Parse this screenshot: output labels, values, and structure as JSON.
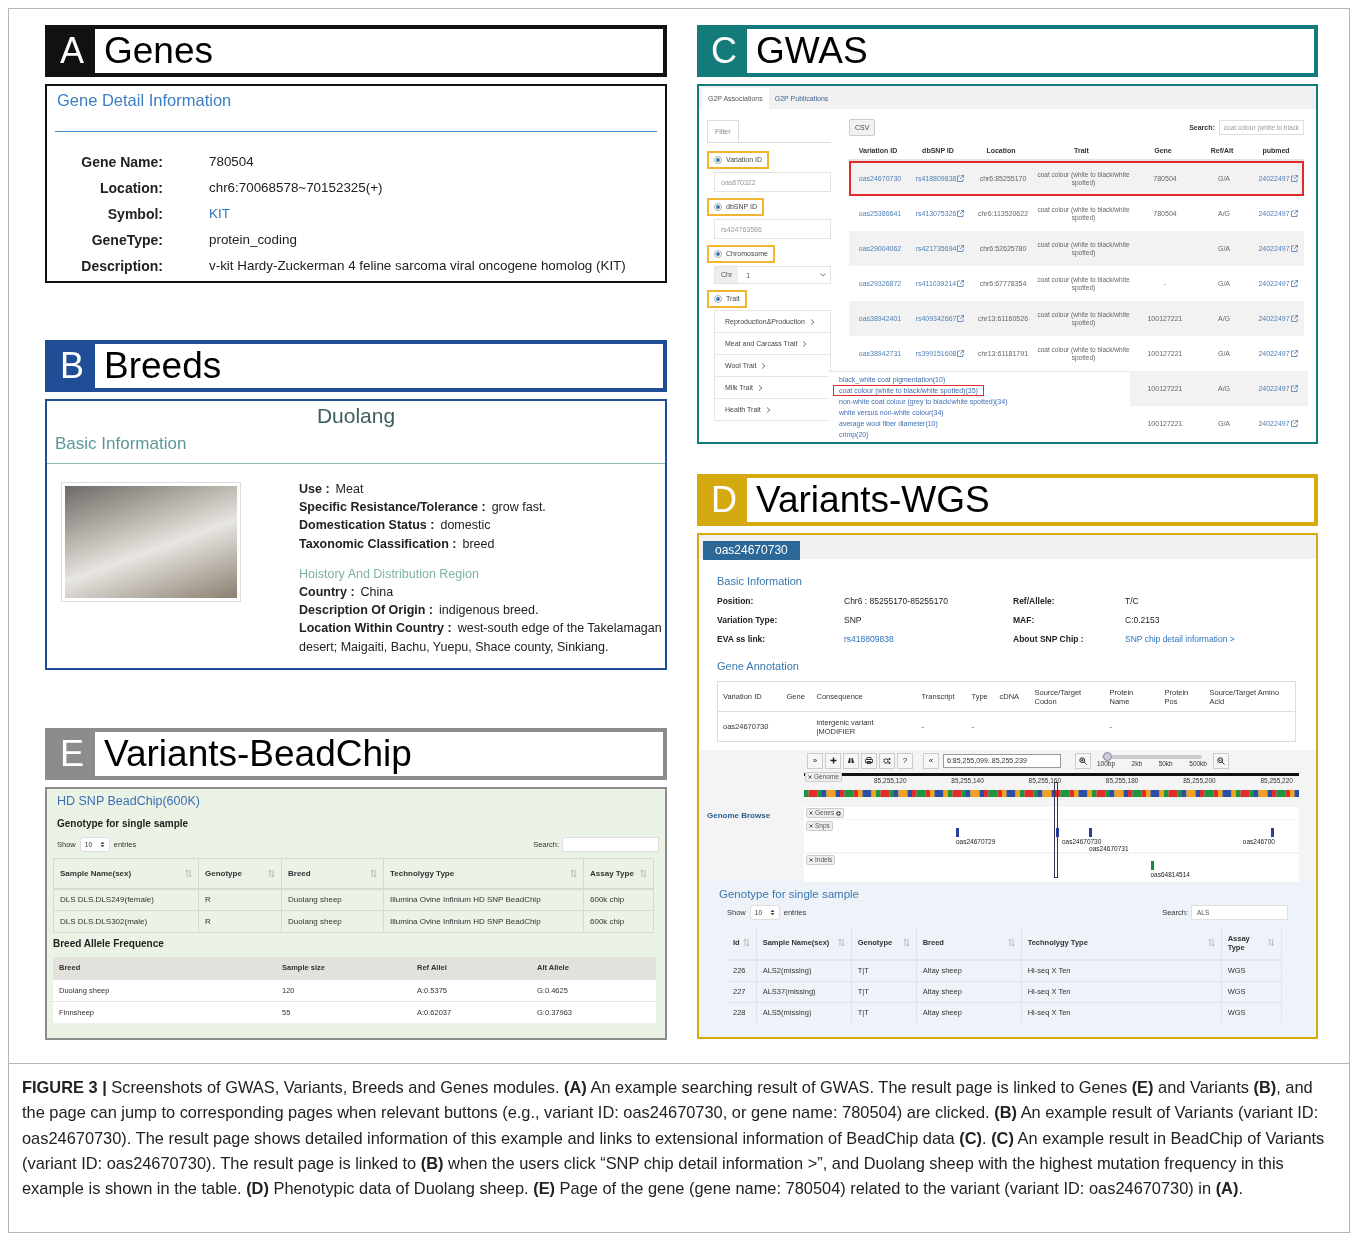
{
  "panel_a": {
    "letter": "A",
    "title": "Genes",
    "section_title": "Gene Detail Information",
    "fields": [
      {
        "label": "Gene Name:",
        "value": "780504",
        "kind": "text"
      },
      {
        "label": "Location:",
        "value": "chr6:70068578~70152325(+)",
        "kind": "text"
      },
      {
        "label": "Symbol:",
        "value": "KIT",
        "kind": "link"
      },
      {
        "label": "GeneType:",
        "value": "protein_coding",
        "kind": "text"
      },
      {
        "label": "Description:",
        "value": "v-kit Hardy-Zuckerman 4 feline sarcoma viral oncogene homolog (KIT)",
        "kind": "text"
      }
    ]
  },
  "panel_b": {
    "letter": "B",
    "title": "Breeds",
    "breed_name": "Duolang",
    "section_title": "Basic Information",
    "traits": [
      {
        "label": "Use :",
        "value": "Meat"
      },
      {
        "label": "Specific Resistance/Tolerance :",
        "value": "grow fast."
      },
      {
        "label": "Domestication Status :",
        "value": "domestic"
      },
      {
        "label": "Taxonomic Classification :",
        "value": "breed"
      }
    ],
    "history_title": "Hoistory And Distribution Region",
    "history": [
      {
        "label": "Country :",
        "value": "China"
      },
      {
        "label": "Description Of Origin :",
        "value": "indigenous breed."
      },
      {
        "label": "Location Within Country :",
        "value": "west-south edge of the Takelamagan desert; Maigaiti, Bachu, Yuepu, Shace county, Sinkiang."
      }
    ]
  },
  "panel_e": {
    "letter": "E",
    "title": "Variants-BeadChip",
    "chip_title": "HD SNP BeadChip(600K)",
    "genotype": {
      "title": "Genotype for single sample",
      "show_label": "Show",
      "page_size": "10",
      "entries_label": "entries",
      "search_label": "Search:",
      "columns": [
        "Sample Name(sex)",
        "Genotype",
        "Breed",
        "Technolygy Type",
        "Assay Type"
      ],
      "rows": [
        [
          "DLS DLS.DLS249(female)",
          "R",
          "Duolang sheep",
          "Illumina Ovine Infinium HD SNP BeadChip",
          "600k chip"
        ],
        [
          "DLS DLS.DLS302(male)",
          "R",
          "Duolang sheep",
          "Illumina Ovine Infinium HD SNP BeadChip",
          "600k chip"
        ]
      ]
    },
    "allele_title": "Breed Allele Frequence",
    "allele_columns": [
      "Breed",
      "Sample size",
      "Ref Allel",
      "Alt Allele"
    ],
    "allele_rows": [
      [
        "Duolang sheep",
        "120",
        "A:0.5375",
        "G:0.4625"
      ],
      [
        "Finnsheep",
        "55",
        "A:0.62037",
        "G:0.37963"
      ]
    ]
  },
  "panel_c": {
    "letter": "C",
    "title": "GWAS",
    "tabs": [
      {
        "label": "G2P Associations",
        "selected": true
      },
      {
        "label": "G2P Publications",
        "selected": false
      }
    ],
    "filter_tab": "Filter",
    "filters": [
      {
        "kind": "input",
        "label": "Variation ID",
        "checked": true,
        "highlighted": true,
        "placeholder": "oas870322"
      },
      {
        "kind": "input",
        "label": "dbSNP ID",
        "checked": true,
        "highlighted": true,
        "placeholder": "rs424763586"
      },
      {
        "kind": "select",
        "label": "Chromosome",
        "checked": true,
        "highlighted": true,
        "prefix": "Chr",
        "value": "1"
      },
      {
        "kind": "categories",
        "label": "Trait",
        "checked": true,
        "highlighted": true,
        "items": [
          "Reproduction&Production",
          "Meat and Carcass Trait",
          "Wool Trait",
          "Milk Trait",
          "Health Trait"
        ]
      }
    ],
    "csv_button": "CSV",
    "search_label": "Search:",
    "search_value": "coat colour (white to black",
    "columns": [
      {
        "label": "Variation ID",
        "kind": "link"
      },
      {
        "label": "dbSNP ID",
        "kind": "external_link"
      },
      {
        "label": "Location",
        "kind": "text"
      },
      {
        "label": "Trait",
        "kind": "wrapped_text"
      },
      {
        "label": "Gene",
        "kind": "text"
      },
      {
        "label": "Ref/Alt",
        "kind": "text"
      },
      {
        "label": "pubmed",
        "kind": "external_link"
      }
    ],
    "rows": [
      {
        "highlighted": true,
        "cells": [
          "oas24670730",
          "rs418809838",
          "chr6:85255170",
          "coat colour (white to black/white spotted)",
          "780504",
          "G/A",
          "24022497"
        ]
      },
      {
        "highlighted": false,
        "cells": [
          "oas25386641",
          "rs413075326",
          "chr6:113520622",
          "coat colour (white to black/white spotted)",
          "780504",
          "A/G",
          "24022497"
        ]
      },
      {
        "highlighted": false,
        "cells": [
          "oas29004062",
          "rs421735694",
          "chr6:52625780",
          "coat colour (white to black/white spotted)",
          null,
          "G/A",
          "24022497"
        ]
      },
      {
        "highlighted": false,
        "cells": [
          "oas29326872",
          "rs411039214",
          "chr6:67778354",
          "coat colour (white to black/white spotted)",
          "-",
          "G/A",
          "24022497"
        ]
      },
      {
        "highlighted": false,
        "cells": [
          "oas38942401",
          "rs409342667",
          "chr13:61160526",
          "coat colour (white to black/white spotted)",
          "100127221",
          "A/G",
          "24022497"
        ]
      },
      {
        "highlighted": false,
        "cells": [
          "oas38942731",
          "rs399151608",
          "chr13:61181791",
          "coat colour (white to black/white spotted)",
          "100127221",
          "G/A",
          "24022497"
        ]
      },
      {
        "highlighted": false,
        "cells": [
          null,
          null,
          null,
          null,
          "100127221",
          "A/G",
          "24022497"
        ]
      },
      {
        "highlighted": false,
        "cells": [
          null,
          null,
          null,
          null,
          "100127221",
          "G/A",
          "24022497"
        ]
      }
    ],
    "trait_suggestions": [
      {
        "label": "black_white coat pigmentation(10)",
        "highlighted": false
      },
      {
        "label": "coat colour (white to black/white spotted)(35)",
        "highlighted": true
      },
      {
        "label": "non-white coat colour (grey to black/white spotted)(34)",
        "highlighted": false
      },
      {
        "label": "white versus non-white colour(34)",
        "highlighted": false
      },
      {
        "label": "average wool fiber diameter(10)",
        "highlighted": false
      },
      {
        "label": "crimp(20)",
        "highlighted": false
      }
    ]
  },
  "panel_d": {
    "letter": "D",
    "title": "Variants-WGS",
    "variant_tab": "oas24670730",
    "basic_title": "Basic Information",
    "basic_fields": [
      {
        "label": "Position:",
        "value": "Chr6 : 85255170-85255170",
        "kind": "text"
      },
      {
        "label": "Ref/Allele:",
        "value": "T/C",
        "kind": "text"
      },
      {
        "label": "Variation Type:",
        "value": "SNP",
        "kind": "text"
      },
      {
        "label": "MAF:",
        "value": "C:0.2153",
        "kind": "text"
      },
      {
        "label": "EVA ss link:",
        "value": "rs418809838",
        "kind": "link"
      },
      {
        "label": "About SNP Chip :",
        "value": "SNP chip detail information >",
        "kind": "link"
      }
    ],
    "annotation_title": "Gene Annotation",
    "annotation_columns": [
      "Variation ID",
      "Gene",
      "Consequence",
      "Transcript",
      "Type",
      "cDNA",
      "Source/Target Codon",
      "Protein Name",
      "Protein Pos",
      "Source/Target Amino Acid"
    ],
    "annotation_rows": [
      [
        "oas24670730",
        null,
        "intergenic variant |MODIFIER",
        "-",
        "-",
        null,
        null,
        "-",
        null,
        null
      ]
    ],
    "genome_browse": {
      "label": "Genome Browse",
      "collapse_button": "»",
      "help_button": "?",
      "back_button": "«",
      "location": "6:85,255,099..85,255,239",
      "zoom": {
        "level": 0.05,
        "labels": [
          "100bp",
          "2kb",
          "50kb",
          "500kb"
        ]
      },
      "ruler": [
        "85,255,120",
        "85,255,140",
        "85,255,160",
        "85,255,180",
        "85,255,200",
        "85,255,220"
      ],
      "reference_label": "Genome",
      "tracks": [
        {
          "kind": "genes",
          "label": "Genes"
        },
        {
          "kind": "snps",
          "label": "Snps",
          "features": [
            "oas24670729",
            "oas24670730",
            "oas24670731",
            "oas246700"
          ]
        },
        {
          "kind": "indels",
          "label": "Indels",
          "features": [
            "oas64814514"
          ]
        }
      ]
    },
    "genotype": {
      "title": "Genotype for single sample",
      "show_label": "Show",
      "page_size": "10",
      "entries_label": "entries",
      "search_label": "Search:",
      "search_value": "ALS",
      "columns": [
        "Id",
        "Sample Name(sex)",
        "Genotype",
        "Breed",
        "Technolygy Type",
        "Assay Type"
      ],
      "rows": [
        [
          "226",
          "ALS2(missing)",
          "T|T",
          "Altay sheep",
          "Hi-seq X Ten",
          "WGS"
        ],
        [
          "227",
          "ALS37(missing)",
          "T|T",
          "Altay sheep",
          "Hi-seq X Ten",
          "WGS"
        ],
        [
          "228",
          "ALS5(missing)",
          "T|T",
          "Altay sheep",
          "Hi-seq X Ten",
          "WGS"
        ]
      ]
    }
  },
  "caption": "**FIGURE 3 |** Screenshots of GWAS, Variants, Breeds and Genes modules. **(A)** An example searching result of GWAS. The result page is linked to Genes **(E)** and Variants **(B)**, and the page can jump to corresponding pages when relevant buttons (e.g., variant ID: oas24670730, or gene name: 780504) are clicked. **(B)** An example result of Variants (variant ID: oas24670730). The result page shows detailed information of this example and links to extensional information of BeadChip data **(C)**. **(C)** An example result in BeadChip of Variants (variant ID: oas24670730). The result page is linked to **(B)** when the users click “SNP chip detail information >”, and Duolang sheep with the highest mutation frequency in this example is shown in the table. **(D)** Phenotypic data of Duolang sheep. **(E)** Page of the gene (gene name: 780504) related to the variant (variant ID: oas24670730) in **(A)**."
}
